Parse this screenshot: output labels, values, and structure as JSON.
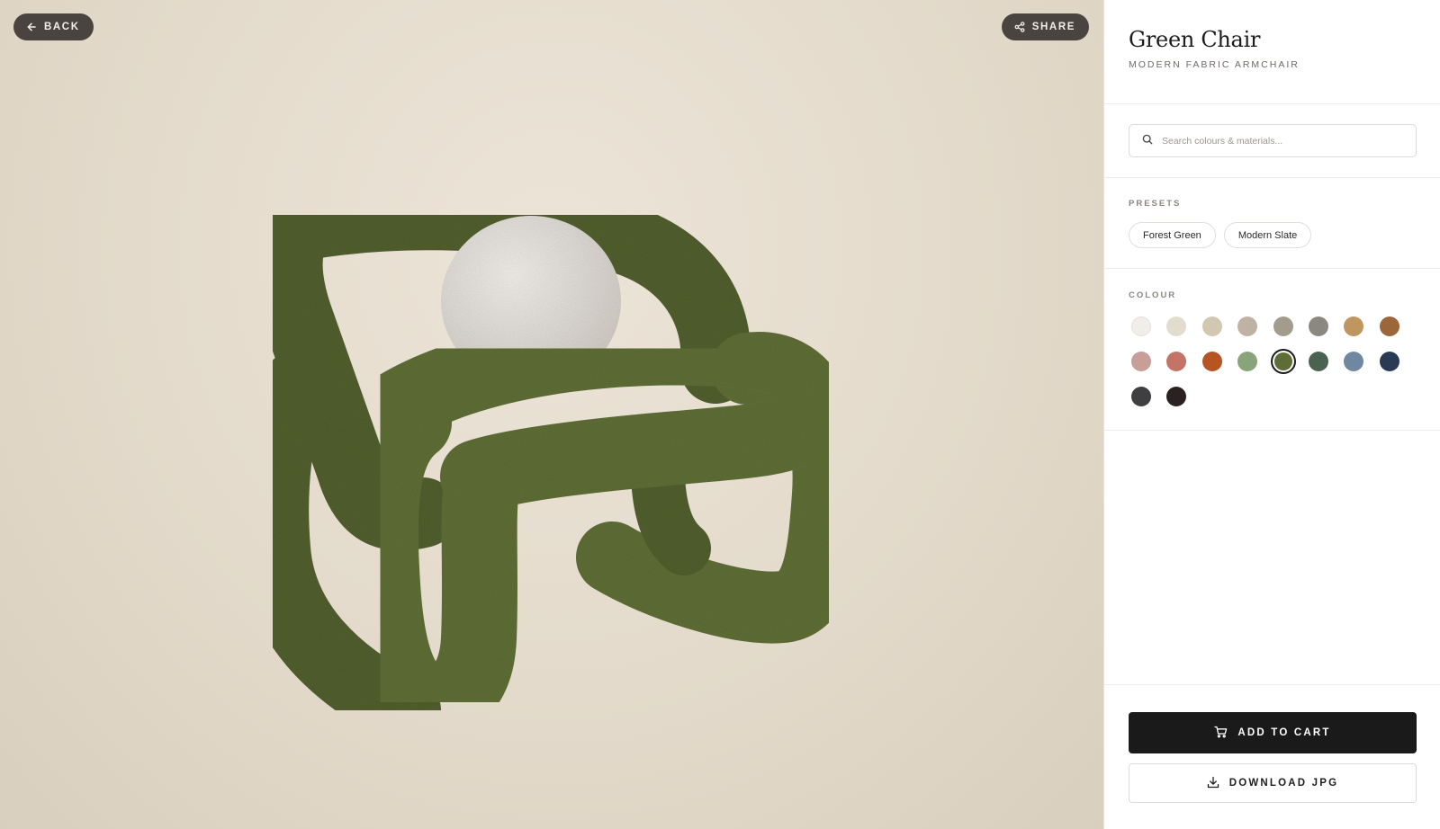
{
  "viewer": {
    "back_label": "BACK",
    "share_label": "SHARE",
    "chair_color": "#5e6d35",
    "pillow_color": "#e4e0dc"
  },
  "product": {
    "title": "Green Chair",
    "subtitle": "MODERN FABRIC ARMCHAIR"
  },
  "search": {
    "placeholder": "Search colours & materials..."
  },
  "presets": {
    "label": "PRESETS",
    "items": [
      "Forest Green",
      "Modern Slate"
    ]
  },
  "colour": {
    "label": "COLOUR",
    "selected": "#5e6d35",
    "swatches": [
      "#f1ede8",
      "#e2dccf",
      "#d2c7b1",
      "#bfb2a4",
      "#a39c8c",
      "#8b8882",
      "#bf9560",
      "#9c6738",
      "#c89e99",
      "#c37466",
      "#b65424",
      "#89a37b",
      "#5e6d35",
      "#4a6250",
      "#6f87a1",
      "#2a3a55",
      "#3f3f41",
      "#2a2221"
    ]
  },
  "actions": {
    "add_to_cart": "ADD TO CART",
    "download": "DOWNLOAD JPG"
  }
}
